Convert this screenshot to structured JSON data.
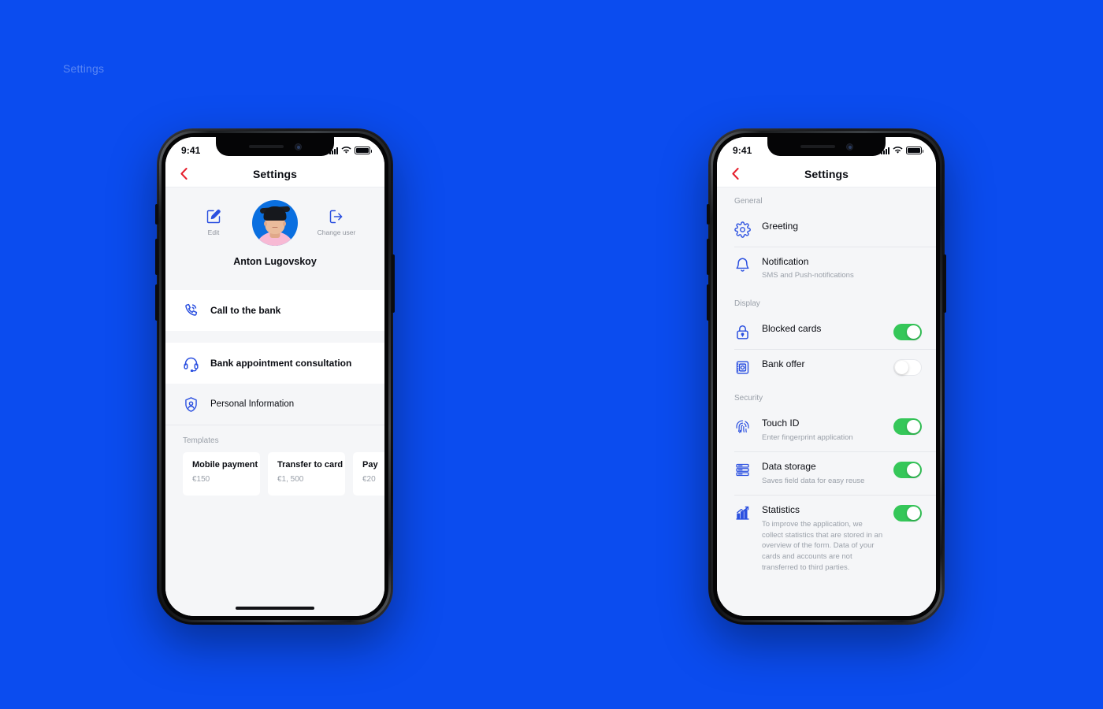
{
  "page": {
    "label": "Settings",
    "background_color": "#0b4cef",
    "accent_blue": "#2b50e0",
    "toggle_on_color": "#35c759",
    "back_arrow_color": "#e6202e"
  },
  "status_bar": {
    "time": "9:41",
    "icons": [
      "cellular-signal-icon",
      "wifi-icon",
      "battery-icon"
    ]
  },
  "left_phone": {
    "nav": {
      "back_icon": "chevron-left-icon",
      "title": "Settings"
    },
    "profile": {
      "edit_action": {
        "icon": "edit-pencil-icon",
        "label": "Edit"
      },
      "change_user_action": {
        "icon": "logout-arrow-icon",
        "label": "Change user"
      },
      "avatar_name": "user-avatar",
      "name": "Anton Lugovskoy"
    },
    "menu": [
      {
        "icon": "phone-call-icon",
        "label": "Call to the bank",
        "style": "card"
      },
      {
        "icon": "headset-icon",
        "label": "Bank appointment consultation",
        "style": "card"
      },
      {
        "icon": "shield-user-icon",
        "label": "Personal Information",
        "style": "plain"
      }
    ],
    "templates": {
      "section_label": "Templates",
      "items": [
        {
          "title": "Mobile payment",
          "amount": "€150"
        },
        {
          "title": "Transfer to card",
          "amount": "€1, 500"
        },
        {
          "title": "Pay",
          "amount": "€20"
        }
      ]
    }
  },
  "right_phone": {
    "nav": {
      "back_icon": "chevron-left-icon",
      "title": "Settings"
    },
    "sections": [
      {
        "label": "General",
        "rows": [
          {
            "icon": "gear-icon",
            "title": "Greeting",
            "subtitle": "",
            "toggle": null
          },
          {
            "icon": "bell-icon",
            "title": "Notification",
            "subtitle": "SMS and Push-notifications",
            "toggle": null
          }
        ]
      },
      {
        "label": "Display",
        "rows": [
          {
            "icon": "lock-icon",
            "title": "Blocked cards",
            "subtitle": "",
            "toggle": "on"
          },
          {
            "icon": "bank-offer-icon",
            "title": "Bank offer",
            "subtitle": "",
            "toggle": "off"
          }
        ]
      },
      {
        "label": "Security",
        "rows": [
          {
            "icon": "fingerprint-icon",
            "title": "Touch ID",
            "subtitle": "Enter fingerprint application",
            "toggle": "on"
          },
          {
            "icon": "data-storage-icon",
            "title": "Data storage",
            "subtitle": "Saves field data for easy reuse",
            "toggle": "on"
          },
          {
            "icon": "statistics-chart-icon",
            "title": "Statistics",
            "subtitle": "To improve the application, we collect statistics that are stored in an overview of the form. Data of your cards and accounts are not transferred to third parties.",
            "toggle": "on"
          }
        ]
      }
    ]
  }
}
